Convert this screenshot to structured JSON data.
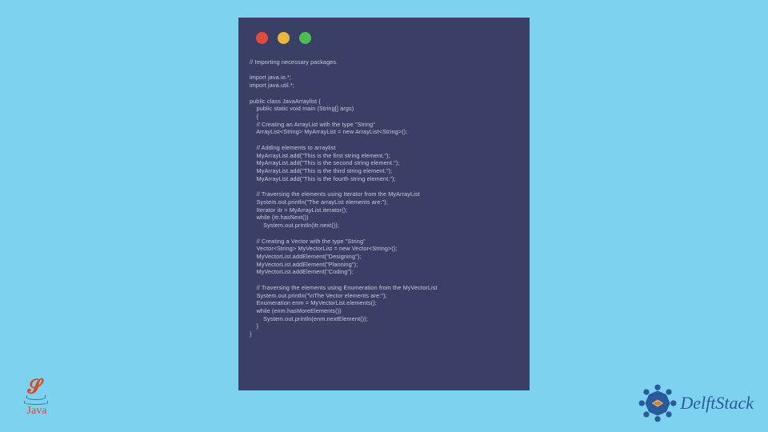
{
  "code": {
    "lines": [
      "// Importing necessary packages.",
      "",
      "import java.io.*;",
      "import java.util.*;",
      "",
      "public class JavaArraylist {",
      "    public static void main (String[] args)",
      "    {",
      "    // Creating an ArrayList with the type \"String\"",
      "    ArrayList<String> MyArrayList = new ArrayList<String>();",
      "",
      "    // Adding elements to arraylist",
      "    MyArrayList.add(\"This is the first string element.\");",
      "    MyArrayList.add(\"This is the second string element.\");",
      "    MyArrayList.add(\"This is the third string element.\");",
      "    MyArrayList.add(\"This is the fourth string element.\");",
      "",
      "    // Traversing the elements using Iterator from the MyArrayList",
      "    System.out.println(\"The arrayList elements are:\");",
      "    Iterator itr = MyArrayList.iterator();",
      "    while (itr.hasNext())",
      "        System.out.println(itr.next());",
      "",
      "    // Creating a Vector with the type \"String\"",
      "    Vector<String> MyVectorList = new Vector<String>();",
      "    MyVectorList.addElement(\"Designing\");",
      "    MyVectorList.addElement(\"Planning\");",
      "    MyVectorList.addElement(\"Coding\");",
      "",
      "    // Traversing the elements using Enumeration from the MyVectorList",
      "    System.out.println(\"\\nThe Vector elements are:\");",
      "    Enumeration enm = MyVectorList.elements();",
      "    while (enm.hasMoreElements())",
      "        System.out.println(enm.nextElement());",
      "    }",
      "}"
    ]
  },
  "logos": {
    "java_text": "Java",
    "delft_text": "DelftStack"
  }
}
